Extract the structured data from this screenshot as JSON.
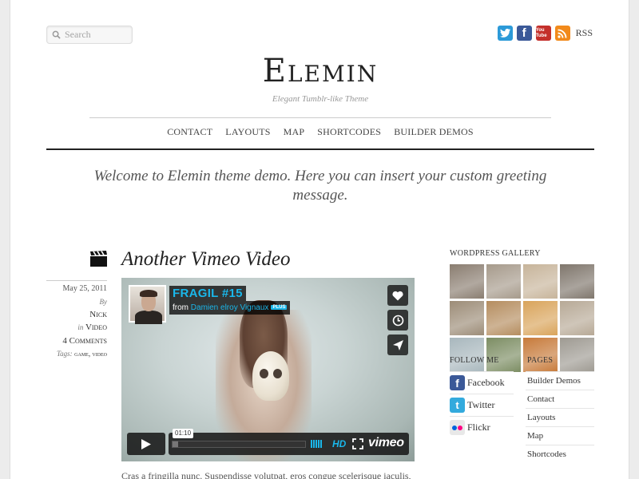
{
  "header": {
    "search_placeholder": "Search",
    "social": {
      "twitter": "twitter-icon",
      "facebook": "facebook-icon",
      "youtube": "youtube-icon",
      "youtube_text": "You Tube",
      "rss": "rss-icon",
      "rss_label": "RSS"
    },
    "site_title": "Elemin",
    "tagline": "Elegant Tumblr-like Theme",
    "nav": [
      "CONTACT",
      "LAYOUTS",
      "MAP",
      "SHORTCODES",
      "BUILDER DEMOS"
    ]
  },
  "welcome": "Welcome to Elemin theme demo. Here you can insert your custom greeting message.",
  "post": {
    "type_icon": "clapperboard-icon",
    "title": "Another Vimeo Video",
    "date": "May 25, 2011",
    "by_label": "By",
    "author": "Nick",
    "in_label": "in",
    "category": "Video",
    "comments": "4 Comments",
    "tags_label": "Tags:",
    "tags": "game, video",
    "excerpt": "Cras a fringilla nunc. Suspendisse volutpat, eros congue scelerisque iaculis,",
    "video": {
      "title": "FRAGIL #15",
      "from_label": "from",
      "author": "Damien elroy Vignaux",
      "badge": "PLUS",
      "timecode": "01:10",
      "hd_label": "HD",
      "brand": "vimeo",
      "progress": 0.04
    }
  },
  "sidebar": {
    "gallery_title": "WORDPRESS GALLERY",
    "gallery_colors": [
      "#8a7d70",
      "#a69a8b",
      "#c7b49a",
      "#7f766c",
      "#9c8c77",
      "#b58d5f",
      "#d9a45b",
      "#b7a996",
      "#a8b7bd",
      "#7c8d63",
      "#c77a3a",
      "#9e9a92"
    ],
    "follow_title": "FOLLOW ME",
    "follow": [
      {
        "label": "Facebook",
        "icon": "facebook-icon",
        "color": "#3b5998",
        "glyph": "f"
      },
      {
        "label": "Twitter",
        "icon": "twitter-icon",
        "color": "#33aadd",
        "glyph": "t"
      },
      {
        "label": "Flickr",
        "icon": "flickr-icon",
        "color": "#e8e8e8",
        "glyph": ""
      }
    ],
    "pages_title": "PAGES",
    "pages": [
      "Builder Demos",
      "Contact",
      "Layouts",
      "Map",
      "Shortcodes"
    ]
  }
}
